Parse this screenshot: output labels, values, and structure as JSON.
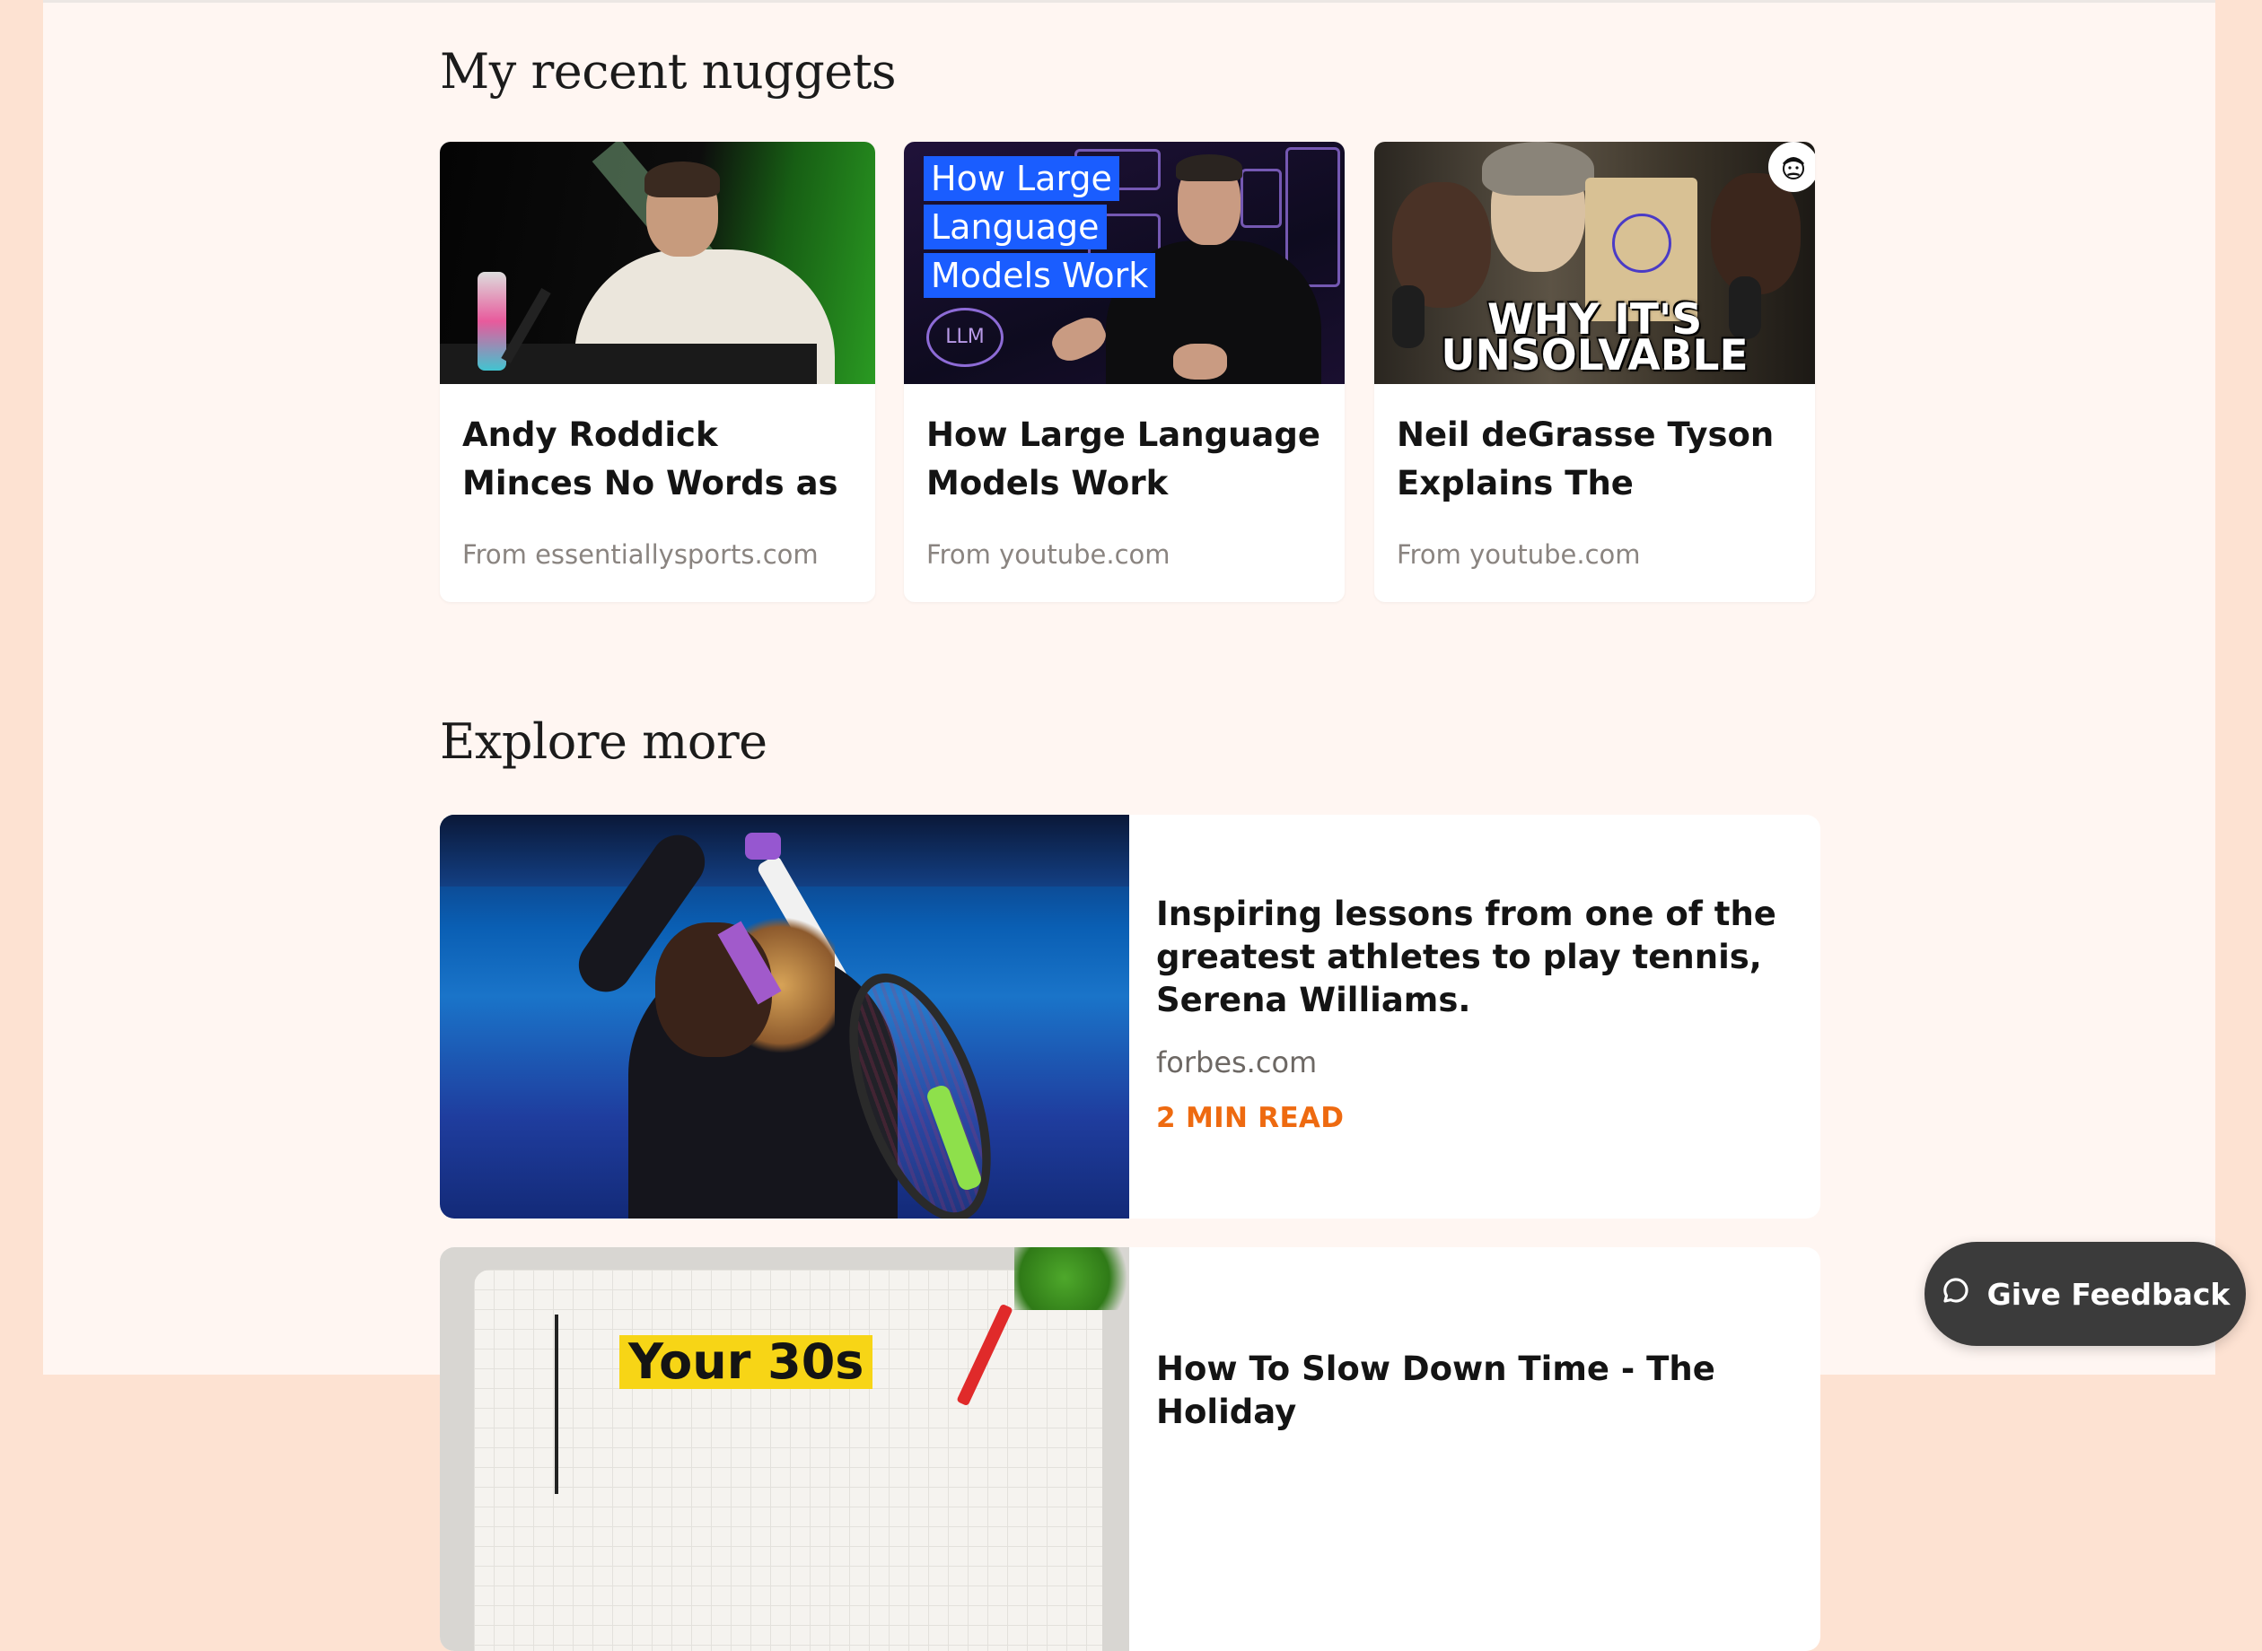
{
  "recent": {
    "heading": "My recent nuggets",
    "items": [
      {
        "title": "Andy Roddick Minces No Words as He...",
        "source": "From essentiallysports.com"
      },
      {
        "title": "How Large Language Models Work",
        "source": "From youtube.com",
        "thumb_caption": [
          "How Large",
          "Language",
          "Models Work"
        ],
        "thumb_doodle": "LLM"
      },
      {
        "title": "Neil deGrasse Tyson Explains The Three-...",
        "source": "From youtube.com",
        "thumb_caption": [
          "WHY IT'S",
          "UNSOLVABLE"
        ]
      }
    ]
  },
  "explore": {
    "heading": "Explore more",
    "items": [
      {
        "title": "Inspiring lessons from one of the greatest athletes to play tennis, Serena Williams.",
        "source": "forbes.com",
        "read_time": "2 MIN READ"
      },
      {
        "title": "How To Slow Down Time - The Holiday",
        "thumb_caption": "Your 30s"
      }
    ]
  },
  "feedback": {
    "label": "Give Feedback",
    "icon": "chat-bubble-icon"
  },
  "colors": {
    "page_bg": "#fff6f2",
    "outer_bg": "#fde2d2",
    "accent": "#ee6a10",
    "feedback_bg": "#3b3b3b"
  }
}
